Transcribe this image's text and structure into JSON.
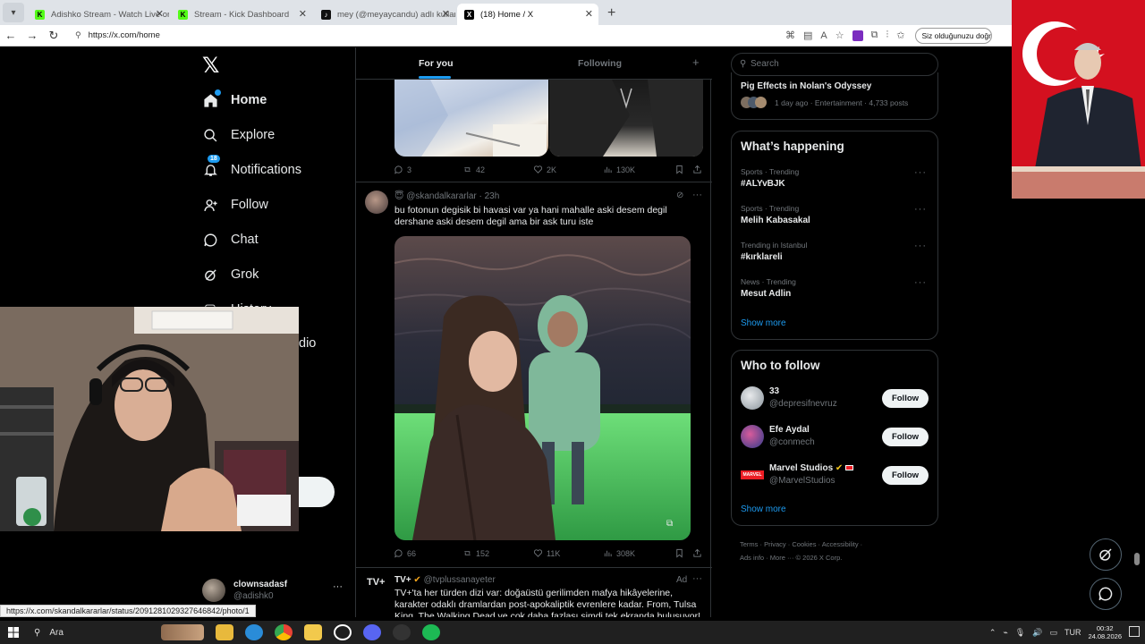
{
  "browser": {
    "tabs": [
      {
        "title": "Adishko Stream - Watch Live on K",
        "favicon": "kick-icon",
        "favicon_color": "#53fc18",
        "active": false
      },
      {
        "title": "Stream - Kick Dashboard",
        "favicon": "kick-icon",
        "favicon_color": "#53fc18",
        "active": false
      },
      {
        "title": "mey (@meyaycandu) adlı kullanıcı",
        "favicon": "tiktok-icon",
        "favicon_color": "#111111",
        "active": false
      },
      {
        "title": "(18) Home / X",
        "favicon": "x-icon",
        "favicon_color": "#000000",
        "active": true
      }
    ],
    "url": "https://x.com/home",
    "search_pill": "Siz olduğunuzu doğru",
    "status_url": "https://x.com/skandalkararlar/status/2091281029327646842/photo/1"
  },
  "nav": {
    "items": [
      {
        "label": "Home",
        "icon": "home-icon"
      },
      {
        "label": "Explore",
        "icon": "search-icon"
      },
      {
        "label": "Notifications",
        "icon": "bell-icon",
        "badge": "18"
      },
      {
        "label": "Follow",
        "icon": "person-plus-icon"
      },
      {
        "label": "Chat",
        "icon": "chat-icon"
      },
      {
        "label": "Grok",
        "icon": "grok-icon"
      }
    ],
    "partial_labels": [
      "History",
      "dio"
    ],
    "account": {
      "name": "clownsadasf",
      "handle": "@adishk0"
    }
  },
  "timeline": {
    "tabs": [
      "For you",
      "Following"
    ],
    "post1_stats": {
      "replies": "3",
      "reposts": "42",
      "likes": "2K",
      "views": "130K"
    },
    "post2": {
      "handle": "@skandalkararlar",
      "time": "23h",
      "text": "bu fotonun degisik bi havasi var ya hani mahalle aski desem degil dershane aski desem degil ama bir ask turu iste",
      "stats": {
        "replies": "66",
        "reposts": "152",
        "likes": "11K",
        "views": "308K"
      }
    },
    "post3": {
      "name": "TV+",
      "handle": "@tvplussanayeter",
      "tag": "Ad",
      "avatar_text": "TV+",
      "text": "TV+'ta her türden dizi var: doğaüstü gerilimden mafya hikâyelerine, karakter odaklı dramlardan post-apokaliptik evrenlere kadar. From, Tulsa King, The Walking Dead ve çok daha fazlası şimdi tek ekranda buluşuyor!"
    }
  },
  "sidebar": {
    "search_placeholder": "Search",
    "top_story": {
      "title": "Pig Effects in Nolan's Odyssey",
      "meta": "1 day ago · Entertainment · 4,733 posts"
    },
    "happening": {
      "title": "What’s happening",
      "trends": [
        {
          "meta": "Sports · Trending",
          "name": "#ALYvBJK"
        },
        {
          "meta": "Sports · Trending",
          "name": "Melih Kabasakal"
        },
        {
          "meta": "Trending in Istanbul",
          "name": "#kırklareli"
        },
        {
          "meta": "News · Trending",
          "name": "Mesut Adlin"
        }
      ],
      "show_more": "Show more"
    },
    "who_to_follow": {
      "title": "Who to follow",
      "accounts": [
        {
          "name": "33",
          "handle": "@depresifnevruz",
          "button": "Follow"
        },
        {
          "name": "Efe Aydal",
          "handle": "@conmech",
          "button": "Follow"
        },
        {
          "name": "Marvel Studios",
          "handle": "@MarvelStudios",
          "button": "Follow"
        }
      ],
      "show_more": "Show more"
    },
    "footer": [
      "Terms",
      "Privacy",
      "Cookies",
      "Accessibility",
      "Ads info",
      "More ···",
      "© 2026 X Corp."
    ]
  },
  "taskbar": {
    "search_label": "Ara",
    "time": "00:32",
    "date": "24.08.2026"
  },
  "colors": {
    "accent": "#1d9bf0",
    "border": "#2f3336",
    "muted": "#71767b"
  }
}
